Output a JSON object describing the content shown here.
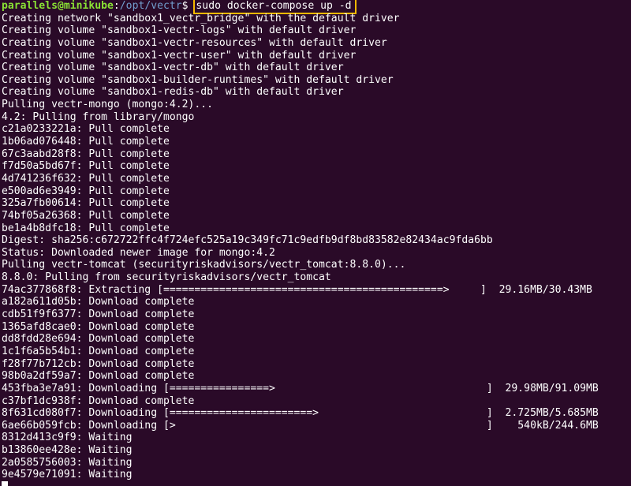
{
  "prompt": {
    "user_host": "parallels@minikube",
    "separator": ":",
    "path": "/opt/vectr",
    "symbol": "$ ",
    "command": "sudo docker-compose up -d"
  },
  "output_lines": [
    "Creating network \"sandbox1_vectr_bridge\" with the default driver",
    "Creating volume \"sandbox1-vectr-logs\" with default driver",
    "Creating volume \"sandbox1-vectr-resources\" with default driver",
    "Creating volume \"sandbox1-vectr-user\" with default driver",
    "Creating volume \"sandbox1-vectr-db\" with default driver",
    "Creating volume \"sandbox1-builder-runtimes\" with default driver",
    "Creating volume \"sandbox1-redis-db\" with default driver",
    "Pulling vectr-mongo (mongo:4.2)...",
    "4.2: Pulling from library/mongo",
    "c21a0233221a: Pull complete",
    "1b06ad076448: Pull complete",
    "67c3aabd28f8: Pull complete",
    "f7d50a5bd67f: Pull complete",
    "4d741236f632: Pull complete",
    "e500ad6e3949: Pull complete",
    "325a7fb00614: Pull complete",
    "74bf05a26368: Pull complete",
    "be1a4b8dfc18: Pull complete",
    "Digest: sha256:c672722ffc4f724efc525a19c349fc71c9edfb9df8bd83582e82434ac9fda6bb",
    "Status: Downloaded newer image for mongo:4.2",
    "Pulling vectr-tomcat (securityriskadvisors/vectr_tomcat:8.8.0)...",
    "8.8.0: Pulling from securityriskadvisors/vectr_tomcat",
    "74ac377868f8: Extracting [=============================================>     ]  29.16MB/30.43MB",
    "a182a611d05b: Download complete",
    "cdb51f9f6377: Download complete",
    "1365afd8cae0: Download complete",
    "dd8fdd28e694: Download complete",
    "1c1f6a5b54b1: Download complete",
    "f28f77b712cb: Download complete",
    "98b0a2df59a7: Download complete",
    "453fba3e7a91: Downloading [================>                                  ]  29.98MB/91.09MB",
    "c37bf1dc938f: Download complete",
    "8f631cd080f7: Downloading [=======================>                           ]  2.725MB/5.685MB",
    "6ae66b059fcb: Downloading [>                                                  ]    540kB/244.6MB",
    "8312d413c9f9: Waiting",
    "b13860ee428e: Waiting",
    "2a0585756003: Waiting",
    "9e4579e71091: Waiting"
  ]
}
